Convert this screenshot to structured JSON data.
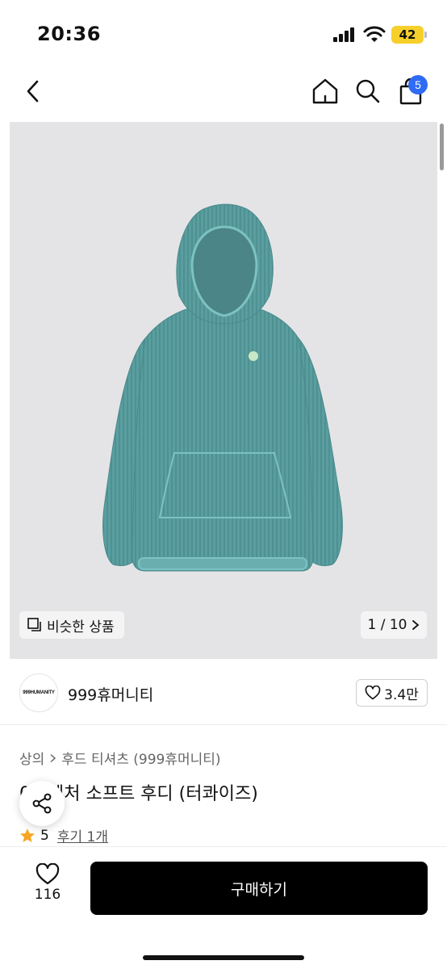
{
  "status_bar": {
    "time": "20:36",
    "battery": "42"
  },
  "nav": {
    "cart_count": "5"
  },
  "gallery": {
    "similar_label": "비슷한 상품",
    "page_indicator": "1 / 10"
  },
  "brand": {
    "logo_text": "999HUMANITY",
    "name": "999휴머니티",
    "like_count": "3.4만"
  },
  "product": {
    "breadcrumb": [
      "상의",
      "후드 티셔츠 (999휴머니티)"
    ],
    "title": "09 벤처 소프트 후디 (터콰이즈)",
    "rating": "5",
    "review_label": "후기 1개",
    "image_color": "#5a9e9f"
  },
  "bottom": {
    "wish_count": "116",
    "buy_label": "구매하기"
  },
  "colors": {
    "accent": "#2f6bf5",
    "star": "#f5a623",
    "buy_button": "#000000"
  }
}
